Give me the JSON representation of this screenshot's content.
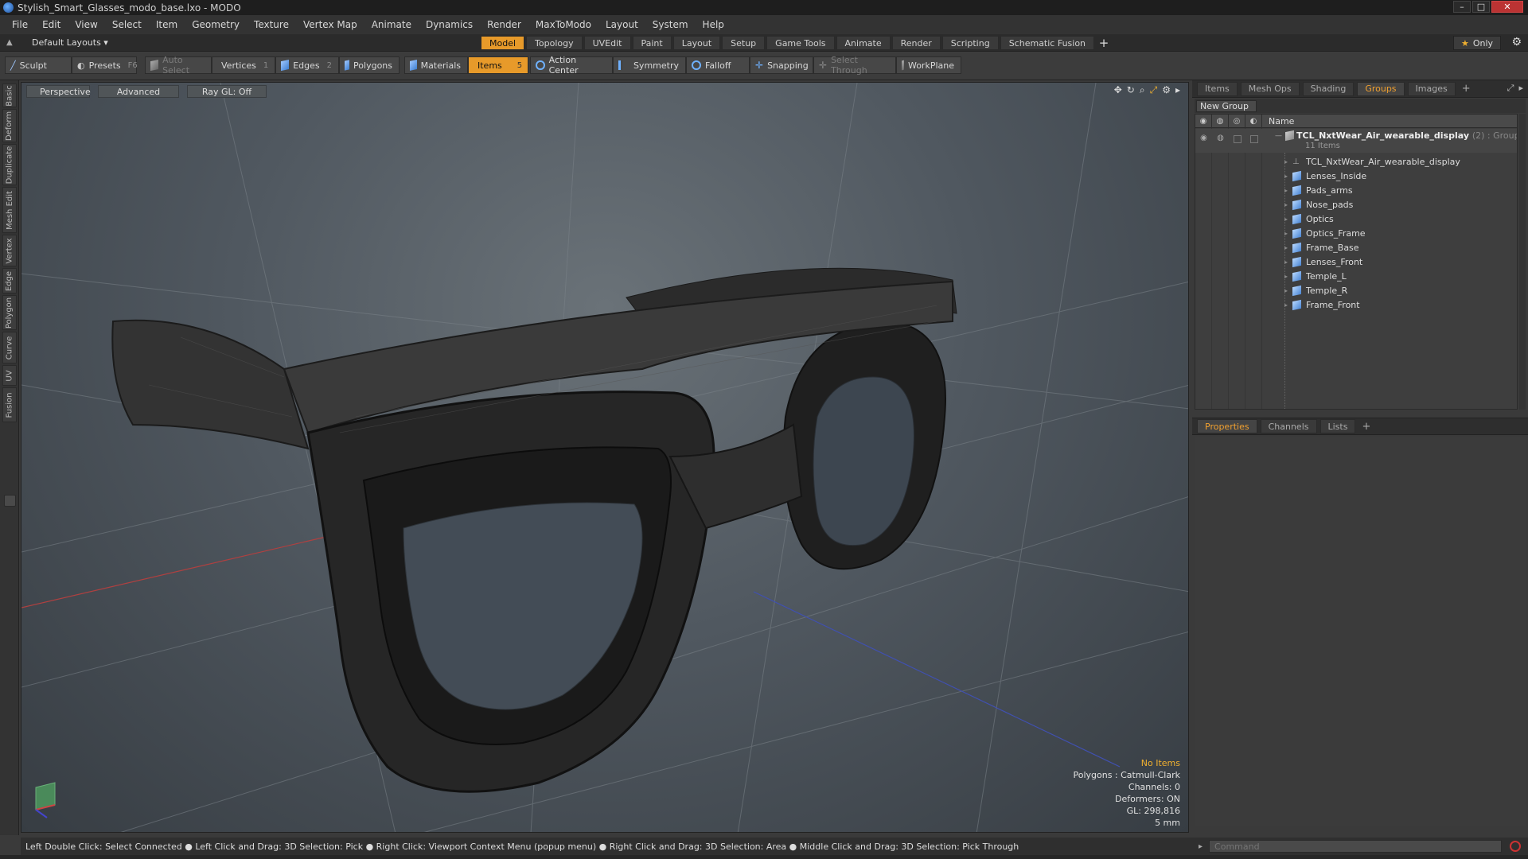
{
  "window": {
    "title": "Stylish_Smart_Glasses_modo_base.lxo - MODO"
  },
  "menu": [
    "File",
    "Edit",
    "View",
    "Select",
    "Item",
    "Geometry",
    "Texture",
    "Vertex Map",
    "Animate",
    "Dynamics",
    "Render",
    "MaxToModo",
    "Layout",
    "System",
    "Help"
  ],
  "layouts": {
    "dropdown": "Default Layouts ▾"
  },
  "tabs": [
    "Model",
    "Topology",
    "UVEdit",
    "Paint",
    "Layout",
    "Setup",
    "Game Tools",
    "Animate",
    "Render",
    "Scripting",
    "Schematic Fusion"
  ],
  "active_tab": "Model",
  "only_label": "Only",
  "toolbar": {
    "sculpt": "Sculpt",
    "presets": "Presets",
    "presets_key": "F6",
    "auto_select": "Auto Select",
    "vertices": "Vertices",
    "vertices_key": "1",
    "edges": "Edges",
    "edges_key": "2",
    "polygons": "Polygons",
    "materials": "Materials",
    "items": "Items",
    "items_key": "5",
    "action_center": "Action Center",
    "symmetry": "Symmetry",
    "falloff": "Falloff",
    "snapping": "Snapping",
    "select_through": "Select Through",
    "workplane": "WorkPlane"
  },
  "left_tabs": [
    "Basic",
    "Deform",
    "Duplicate",
    "Mesh Edit",
    "Vertex",
    "Edge",
    "Polygon",
    "Curve",
    "UV",
    "Fusion"
  ],
  "viewport": {
    "view": "Perspective",
    "shading": "Advanced",
    "raygl": "Ray GL: Off",
    "info": {
      "selection": "No Items",
      "polygons": "Polygons : Catmull-Clark",
      "channels": "Channels: 0",
      "deformers": "Deformers: ON",
      "gl": "GL: 298,816",
      "unit": "5 mm"
    }
  },
  "right_panel": {
    "tabs": [
      "Items",
      "Mesh Ops",
      "Shading",
      "Groups",
      "Images"
    ],
    "active_tab": "Groups",
    "new_group": "New Group",
    "name_header": "Name",
    "group": {
      "name": "TCL_NxtWear_Air_wearable_display",
      "meta": "(2) : Group",
      "count": "11 Items"
    },
    "items": [
      {
        "label": "TCL_NxtWear_Air_wearable_display",
        "kind": "locator"
      },
      {
        "label": "Lenses_Inside",
        "kind": "mesh"
      },
      {
        "label": "Pads_arms",
        "kind": "mesh"
      },
      {
        "label": "Nose_pads",
        "kind": "mesh"
      },
      {
        "label": "Optics",
        "kind": "mesh"
      },
      {
        "label": "Optics_Frame",
        "kind": "mesh"
      },
      {
        "label": "Frame_Base",
        "kind": "mesh"
      },
      {
        "label": "Lenses_Front",
        "kind": "mesh"
      },
      {
        "label": "Temple_L",
        "kind": "mesh"
      },
      {
        "label": "Temple_R",
        "kind": "mesh"
      },
      {
        "label": "Frame_Front",
        "kind": "mesh"
      }
    ],
    "prop_tabs": [
      "Properties",
      "Channels",
      "Lists"
    ],
    "active_prop_tab": "Properties"
  },
  "status": {
    "hint": "Left Double Click: Select Connected ● Left Click and Drag: 3D Selection: Pick ● Right Click: Viewport Context Menu (popup menu) ● Right Click and Drag: 3D Selection: Area ● Middle Click and Drag: 3D Selection: Pick Through"
  },
  "command": {
    "placeholder": "Command"
  },
  "colors": {
    "accent": "#e79a2a",
    "selection_text": "#f0b030"
  }
}
